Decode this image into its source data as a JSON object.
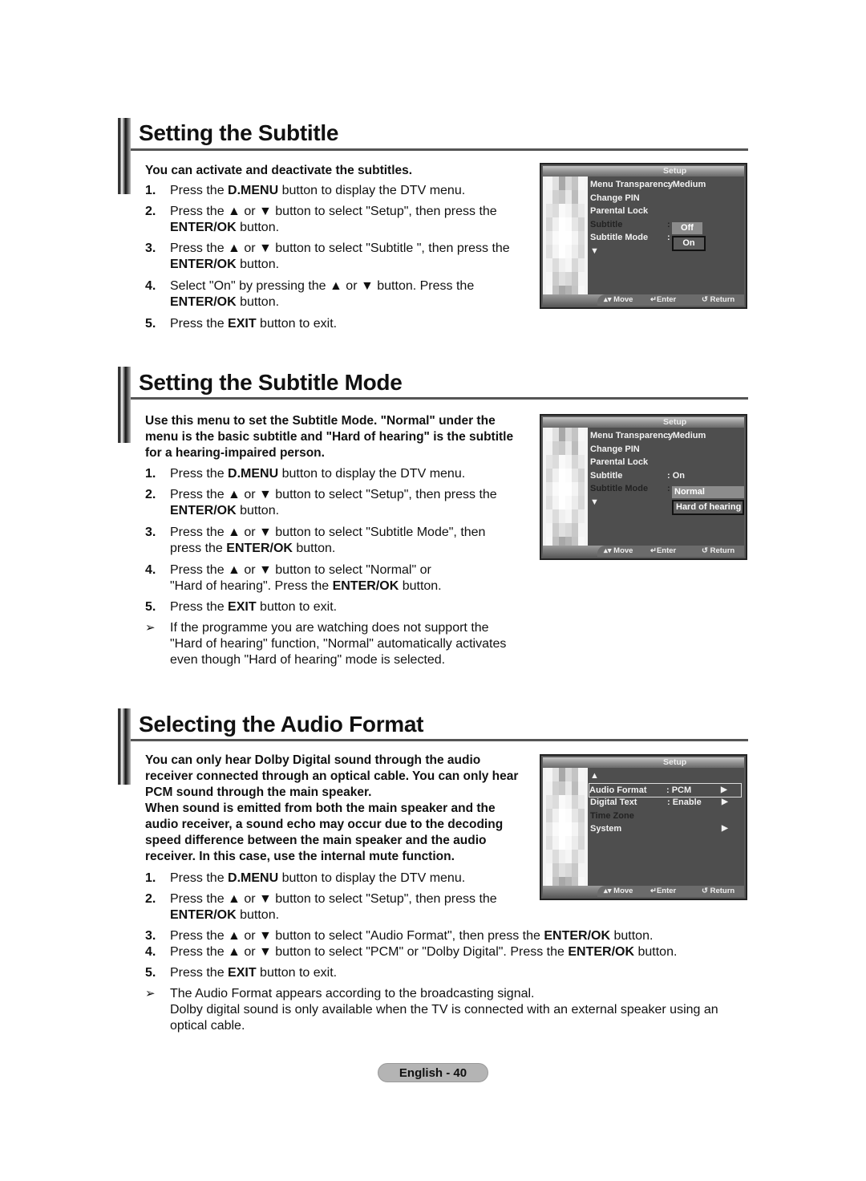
{
  "sections": [
    {
      "title": "Setting the Subtitle",
      "intro": "You can activate and deactivate the subtitles.",
      "steps": [
        {
          "num": "1.",
          "parts": [
            [
              "Press the ",
              false
            ],
            [
              "D.MENU",
              true
            ],
            [
              " button to display the DTV menu.",
              false
            ]
          ]
        },
        {
          "num": "2.",
          "parts": [
            [
              "Press the ▲ or ▼ button to select \"Setup\", then press the",
              false
            ]
          ],
          "parts2": [
            [
              "ENTER/OK",
              true
            ],
            [
              " button.",
              false
            ]
          ]
        },
        {
          "num": "3.",
          "parts": [
            [
              "Press the ▲ or ▼ button to select \"Subtitle \", then press the",
              false
            ]
          ],
          "parts2": [
            [
              "ENTER/OK",
              true
            ],
            [
              " button.",
              false
            ]
          ]
        },
        {
          "num": "4.",
          "parts": [
            [
              "Select \"On\" by pressing the ▲ or ▼ button. Press the",
              false
            ]
          ],
          "parts2": [
            [
              "ENTER/OK",
              true
            ],
            [
              " button.",
              false
            ]
          ]
        },
        {
          "num": "5.",
          "parts": [
            [
              "Press the ",
              false
            ],
            [
              "EXIT",
              true
            ],
            [
              " button to exit.",
              false
            ]
          ]
        }
      ],
      "osd": {
        "header": "Setup",
        "rows": [
          {
            "label": "Menu Transparency",
            "value": ": Medium"
          },
          {
            "label": "Change PIN",
            "value": ""
          },
          {
            "label": "Parental Lock",
            "value": ""
          },
          {
            "label": "Subtitle",
            "value": ":",
            "state": "dim"
          },
          {
            "label": "Subtitle  Mode",
            "value": ":"
          },
          {
            "label": "▼",
            "value": ""
          }
        ],
        "options": [
          {
            "label": "Off",
            "state": "highlighted"
          },
          {
            "label": "On",
            "state": "boxed"
          }
        ],
        "footer": {
          "move": "▴▾ Move",
          "enter": "↵Enter",
          "return": "↺ Return"
        }
      }
    },
    {
      "title": "Setting the Subtitle Mode",
      "intro": "Use this menu to set the Subtitle Mode. \"Normal\" under the menu is the basic subtitle and \"Hard of hearing\" is the subtitle for a hearing-impaired person.",
      "steps": [
        {
          "num": "1.",
          "parts": [
            [
              "Press the ",
              false
            ],
            [
              "D.MENU",
              true
            ],
            [
              " button to display the DTV menu.",
              false
            ]
          ]
        },
        {
          "num": "2.",
          "parts": [
            [
              "Press the ▲ or ▼ button to select \"Setup\", then press the",
              false
            ]
          ],
          "parts2": [
            [
              "ENTER/OK",
              true
            ],
            [
              " button.",
              false
            ]
          ]
        },
        {
          "num": "3.",
          "parts": [
            [
              "Press the ▲ or ▼ button to select \"Subtitle  Mode\", then",
              false
            ]
          ],
          "parts2": [
            [
              "press the ",
              false
            ],
            [
              "ENTER/OK",
              true
            ],
            [
              " button.",
              false
            ]
          ]
        },
        {
          "num": "4.",
          "parts": [
            [
              "Press the ▲ or ▼ button to select \"Normal\" or",
              false
            ]
          ],
          "parts2": [
            [
              "\"Hard of hearing\". Press the ",
              false
            ],
            [
              "ENTER/OK",
              true
            ],
            [
              " button.",
              false
            ]
          ]
        },
        {
          "num": "5.",
          "parts": [
            [
              "Press the ",
              false
            ],
            [
              "EXIT",
              true
            ],
            [
              " button to exit.",
              false
            ]
          ]
        }
      ],
      "note": {
        "symbol": "➢",
        "lines": [
          "If the programme you are watching does not support the",
          "\"Hard of hearing\" function, \"Normal\" automatically activates",
          "even though \"Hard of hearing\" mode is selected."
        ]
      },
      "osd": {
        "header": "Setup",
        "rows": [
          {
            "label": "Menu Transparency",
            "value": ": Medium"
          },
          {
            "label": "Change PIN",
            "value": ""
          },
          {
            "label": "Parental Lock",
            "value": ""
          },
          {
            "label": "Subtitle",
            "value": ": On"
          },
          {
            "label": "Subtitle  Mode",
            "value": ":",
            "state": "dim"
          },
          {
            "label": "▼",
            "value": ""
          }
        ],
        "options": [
          {
            "label": "Normal",
            "state": "highlighted"
          },
          {
            "label": "Hard of hearing",
            "state": "boxed"
          }
        ],
        "footer": {
          "move": "▴▾ Move",
          "enter": "↵Enter",
          "return": "↺ Return"
        }
      }
    },
    {
      "title": "Selecting the Audio Format",
      "intro": "You can only hear Dolby Digital sound through the audio receiver connected through an optical cable. You can only hear PCM sound through the main speaker.",
      "intro2": "When sound is emitted from both the main speaker and the audio receiver, a sound echo may occur due to the decoding speed difference between the main speaker and the audio receiver. In this case, use the internal mute function.",
      "steps": [
        {
          "num": "1.",
          "parts": [
            [
              "Press the ",
              false
            ],
            [
              "D.MENU",
              true
            ],
            [
              " button to display the DTV menu.",
              false
            ]
          ]
        },
        {
          "num": "2.",
          "parts": [
            [
              "Press the ▲ or ▼ button to select \"Setup\", then press the",
              false
            ]
          ],
          "parts2": [
            [
              "ENTER/OK",
              true
            ],
            [
              " button.",
              false
            ]
          ]
        },
        {
          "num": "3.",
          "parts": [
            [
              "Press the ▲ or ▼ button to select \"Audio Format\", then press the ",
              false
            ],
            [
              "ENTER/OK",
              true
            ],
            [
              " button.",
              false
            ]
          ]
        },
        {
          "num": "4.",
          "parts": [
            [
              "Press the ▲ or ▼ button to select \"PCM\" or \"Dolby Digital\". Press the ",
              false
            ],
            [
              "ENTER/OK",
              true
            ],
            [
              " button.",
              false
            ]
          ]
        },
        {
          "num": "5.",
          "parts": [
            [
              "Press the ",
              false
            ],
            [
              "EXIT",
              true
            ],
            [
              " button to exit.",
              false
            ]
          ]
        }
      ],
      "note": {
        "symbol": "➢",
        "lines": [
          "The Audio Format appears according to the broadcasting signal.",
          "Dolby digital sound is only available when the TV is connected with an external speaker using an",
          "optical cable."
        ]
      },
      "osd": {
        "header": "Setup",
        "rows": [
          {
            "label": "▲",
            "value": ""
          },
          {
            "label": "Audio Format",
            "value": ": PCM",
            "arrow": "▶",
            "state": "selected"
          },
          {
            "label": "Digital Text",
            "value": ": Enable",
            "arrow": "▶"
          },
          {
            "label": "Time Zone",
            "value": "",
            "state": "dim"
          },
          {
            "label": "System",
            "value": "",
            "arrow": "▶"
          }
        ],
        "footer": {
          "move": "▴▾ Move",
          "enter": "↵Enter",
          "return": "↺ Return"
        }
      }
    }
  ],
  "footer": {
    "page_label": "English - 40"
  }
}
